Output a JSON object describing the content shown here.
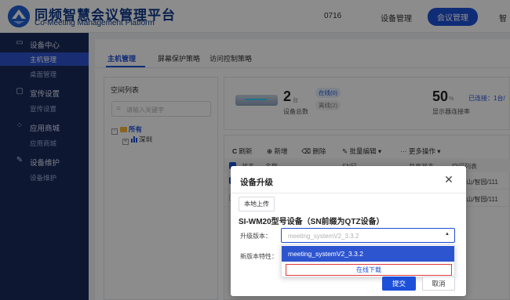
{
  "header": {
    "app_title": "同频智慧会议管理平台",
    "app_subtitle": "Co-Meeting Management Platform",
    "code": "0716",
    "nav": [
      "设备管理",
      "会议管理",
      "智"
    ],
    "active_nav_index": 1
  },
  "sidebar": {
    "groups": [
      {
        "label": "设备中心",
        "icon": "monitor-icon",
        "items": [
          "主机管理",
          "桌面管理"
        ]
      },
      {
        "label": "宣传设置",
        "icon": "display-icon",
        "items": [
          "宣传设置"
        ]
      },
      {
        "label": "应用商城",
        "icon": "grid-icon",
        "items": [
          "应用商城"
        ]
      },
      {
        "label": "设备维护",
        "icon": "wrench-icon",
        "items": [
          "设备维护"
        ]
      }
    ],
    "active_item": "主机管理"
  },
  "tabs": [
    "主机管理",
    "屏幕保护策略",
    "访问控制策略"
  ],
  "space_list": {
    "title": "空间列表",
    "search_placeholder": "请输入关键字",
    "tree": [
      {
        "label": "所有",
        "expander": "-",
        "level": 0
      },
      {
        "label": "深圳",
        "expander": "+",
        "level": 1
      }
    ]
  },
  "stats": {
    "device_count": "2",
    "device_unit": "台",
    "device_label": "设备总数",
    "online": "在线(0)",
    "offline": "离线(2)",
    "conn_rate": "50",
    "conn_unit": "%",
    "conn_label": "显示器连接率",
    "connected": "已连接：1台/"
  },
  "toolbar": {
    "refresh": "刷新",
    "add": "新增",
    "delete": "删除",
    "batch_edit": "批量编辑",
    "more": "更多操作"
  },
  "table": {
    "columns": [
      "状态",
      "名称",
      "SN码",
      "共享状态",
      "空间列表"
    ],
    "rows": [
      {
        "space": "圳/南山/智园/111"
      },
      {
        "space": "圳/南山/智园/111"
      }
    ]
  },
  "modal": {
    "title": "设备升级",
    "local_upload": "本地上传",
    "model_title": "SI-WM20型号设备（SN前缀为QTZ设备）",
    "version_label": "升级版本：",
    "version_placeholder": "meeting_systemV2_3.3.2",
    "feature_label": "新版本特性：",
    "dropdown_option": "meeting_systemV2_3.3.2",
    "online_download": "在线下载",
    "submit": "提交",
    "cancel": "取消"
  },
  "colors": {
    "primary": "#1d50d8",
    "sidebar_bg": "#1a2a5c",
    "highlight_border": "#e03b3b"
  }
}
